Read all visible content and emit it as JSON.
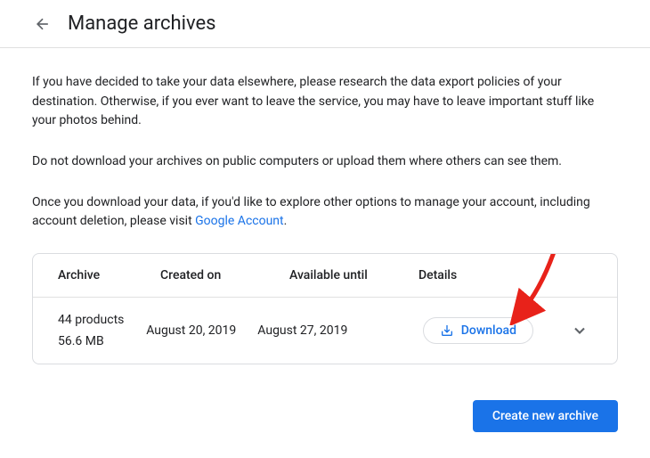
{
  "header": {
    "title": "Manage archives"
  },
  "paragraphs": {
    "p1": "If you have decided to take your data elsewhere, please research the data export policies of your destination. Otherwise, if you ever want to leave the service, you may have to leave important stuff like your photos behind.",
    "p2": "Do not download your archives on public computers or upload them where others can see them.",
    "p3_prefix": "Once you download your data, if you'd like to explore other options to manage your account, including account deletion, please visit ",
    "p3_link": "Google Account",
    "p3_suffix": "."
  },
  "table": {
    "headers": {
      "archive": "Archive",
      "created": "Created on",
      "available": "Available until",
      "details": "Details"
    },
    "rows": [
      {
        "products": "44 products",
        "size": "56.6 MB",
        "created": "August 20, 2019",
        "available": "August 27, 2019",
        "download_label": "Download"
      }
    ]
  },
  "footer": {
    "create_label": "Create new archive"
  }
}
